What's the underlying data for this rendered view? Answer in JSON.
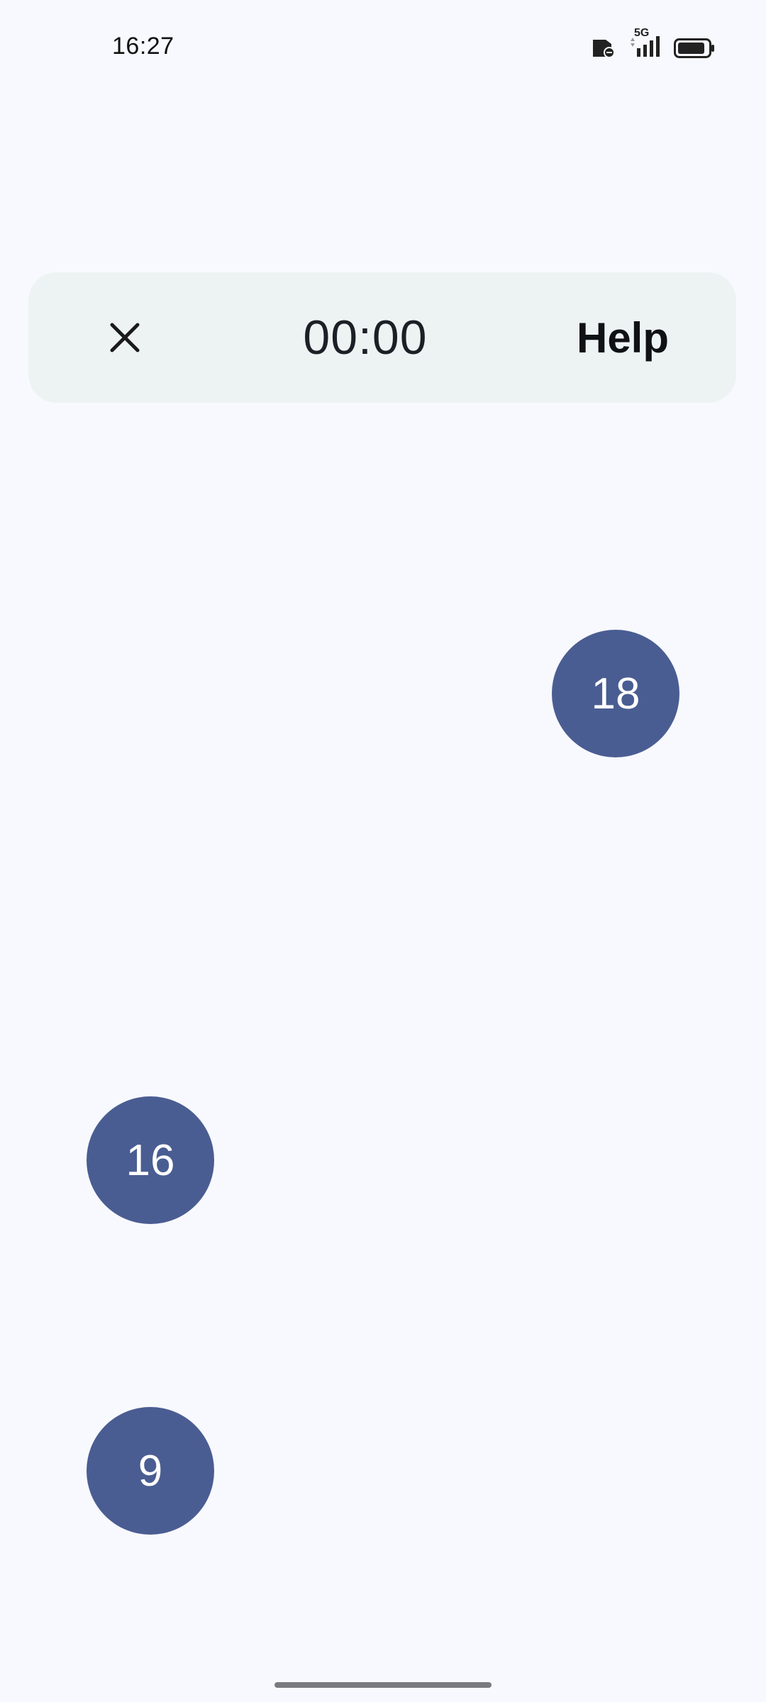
{
  "status_bar": {
    "time": "16:27",
    "network_label": "5G",
    "icons": [
      "sim-card-icon",
      "signal-strength-icon",
      "battery-icon"
    ]
  },
  "toolbar": {
    "close_icon": "close-icon",
    "timer": "00:00",
    "help_label": "Help"
  },
  "bubbles": [
    {
      "label": "18"
    },
    {
      "label": "16"
    },
    {
      "label": "9"
    }
  ],
  "colors": {
    "background": "#f8f9fe",
    "toolbar_bg": "#edf3f2",
    "bubble": "#4a5d92",
    "bubble_text": "#ffffff"
  }
}
